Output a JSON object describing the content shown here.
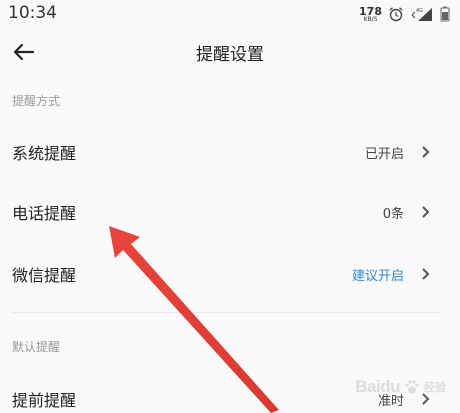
{
  "status_bar": {
    "time": "10:34",
    "net_speed": "178",
    "net_unit": "KB/S",
    "icons": [
      "alarm-icon",
      "signal-4g-icon",
      "battery-icon"
    ]
  },
  "header": {
    "title": "提醒设置",
    "back_icon": "back-arrow-icon"
  },
  "sections": [
    {
      "header": "提醒方式",
      "rows": [
        {
          "label": "系统提醒",
          "value": "已开启",
          "value_color": "#444444"
        },
        {
          "label": "电话提醒",
          "value": "0条",
          "value_color": "#444444"
        },
        {
          "label": "微信提醒",
          "value": "建议开启",
          "value_color": "#2b88d8"
        }
      ]
    },
    {
      "header": "默认提醒",
      "rows": [
        {
          "label": "提前提醒",
          "value": "准时",
          "value_color": "#444444"
        }
      ]
    }
  ],
  "annotation": {
    "type": "red-arrow",
    "color": "#e8453c",
    "points_to": "电话提醒"
  },
  "watermark": {
    "logo": "Baidu",
    "text": "经验"
  },
  "colors": {
    "accent_blue": "#2b88d8",
    "background": "#fafafa",
    "annotation_red": "#e8453c"
  }
}
